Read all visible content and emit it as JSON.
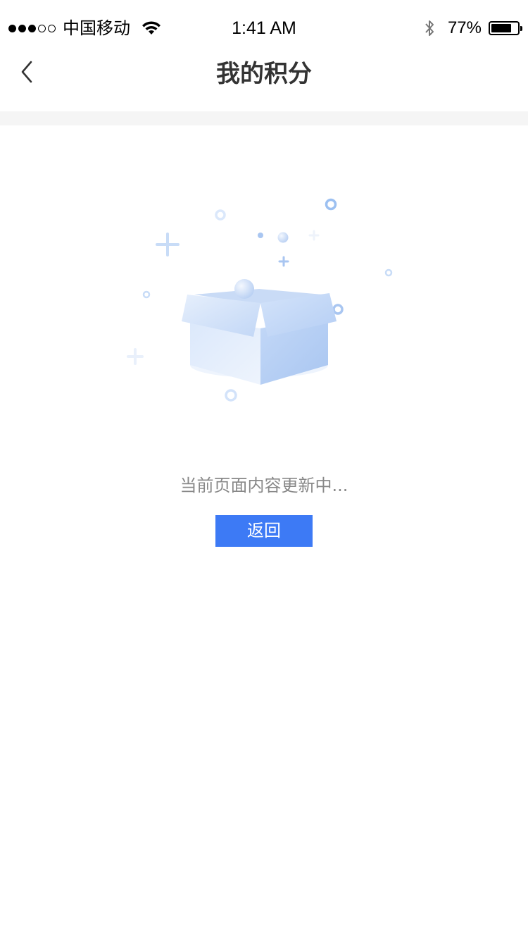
{
  "status_bar": {
    "carrier": "中国移动",
    "time": "1:41 AM",
    "battery_percent": "77%",
    "battery_level": 0.77,
    "signal_strength": 3,
    "signal_max": 5,
    "icons": [
      "signal-dots-icon",
      "wifi-icon",
      "bluetooth-icon",
      "battery-icon"
    ]
  },
  "nav": {
    "title": "我的积分",
    "back_icon": "chevron-left-icon"
  },
  "empty_state": {
    "illustration": "open-box-icon",
    "message": "当前页面内容更新中...",
    "button_label": "返回"
  },
  "colors": {
    "accent": "#3d7af5",
    "title": "#333333",
    "muted_text": "#888888",
    "divider": "#f5f5f5",
    "illustration_blue": "#a9c8f5"
  }
}
